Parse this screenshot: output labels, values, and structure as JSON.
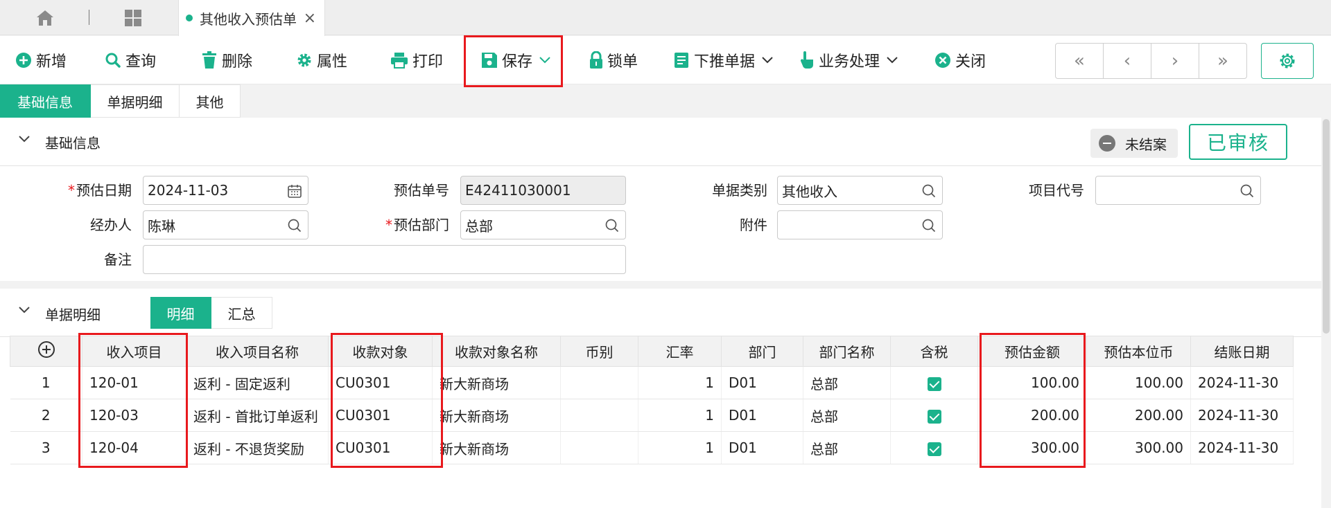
{
  "tabbar": {
    "active_tab": "其他收入预估单"
  },
  "toolbar": {
    "new": "新增",
    "query": "查询",
    "delete": "删除",
    "props": "属性",
    "print": "打印",
    "save": "保存",
    "lock": "锁单",
    "push": "下推单据",
    "business": "业务处理",
    "close": "关闭"
  },
  "section_tabs": [
    "基础信息",
    "单据明细",
    "其他"
  ],
  "base_info": {
    "title": "基础信息",
    "status": "未结案",
    "approval": "已审核",
    "fields": {
      "est_date_label": "预估日期",
      "est_date": "2024-11-03",
      "est_no_label": "预估单号",
      "est_no": "E42411030001",
      "doc_type_label": "单据类别",
      "doc_type": "其他收入",
      "project_label": "项目代号",
      "project": "",
      "handler_label": "经办人",
      "handler": "陈琳",
      "dept_label": "预估部门",
      "dept": "总部",
      "attach_label": "附件",
      "attach": "",
      "remark_label": "备注",
      "remark": ""
    }
  },
  "detail": {
    "title": "单据明细",
    "sub_tabs": [
      "明细",
      "汇总"
    ],
    "columns": [
      "收入项目",
      "收入项目名称",
      "收款对象",
      "收款对象名称",
      "币别",
      "汇率",
      "部门",
      "部门名称",
      "含税",
      "预估金额",
      "预估本位币",
      "结账日期"
    ],
    "rows": [
      {
        "no": "1",
        "item": "120-01",
        "item_name": "返利 - 固定返利",
        "payer": "CU0301",
        "payer_name": "新大新商场",
        "currency": "",
        "rate": "1",
        "dept": "D01",
        "dept_name": "总部",
        "tax": true,
        "amount": "100.00",
        "base": "100.00",
        "close_date": "2024-11-30"
      },
      {
        "no": "2",
        "item": "120-03",
        "item_name": "返利 - 首批订单返利",
        "payer": "CU0301",
        "payer_name": "新大新商场",
        "currency": "",
        "rate": "1",
        "dept": "D01",
        "dept_name": "总部",
        "tax": true,
        "amount": "200.00",
        "base": "200.00",
        "close_date": "2024-11-30"
      },
      {
        "no": "3",
        "item": "120-04",
        "item_name": "返利 - 不退货奖励",
        "payer": "CU0301",
        "payer_name": "新大新商场",
        "currency": "",
        "rate": "1",
        "dept": "D01",
        "dept_name": "总部",
        "tax": true,
        "amount": "300.00",
        "base": "300.00",
        "close_date": "2024-11-30"
      }
    ]
  },
  "colors": {
    "accent": "#1bb28c",
    "highlight": "#e8191d"
  },
  "icons": [
    "home-icon",
    "grid-icon",
    "plus-circle-icon",
    "search-icon",
    "trash-icon",
    "gear-icon",
    "printer-icon",
    "floppy-icon",
    "lock-icon",
    "document-icon",
    "hand-pointer-icon",
    "close-circle-icon",
    "calendar-icon",
    "chevron-down-icon"
  ]
}
